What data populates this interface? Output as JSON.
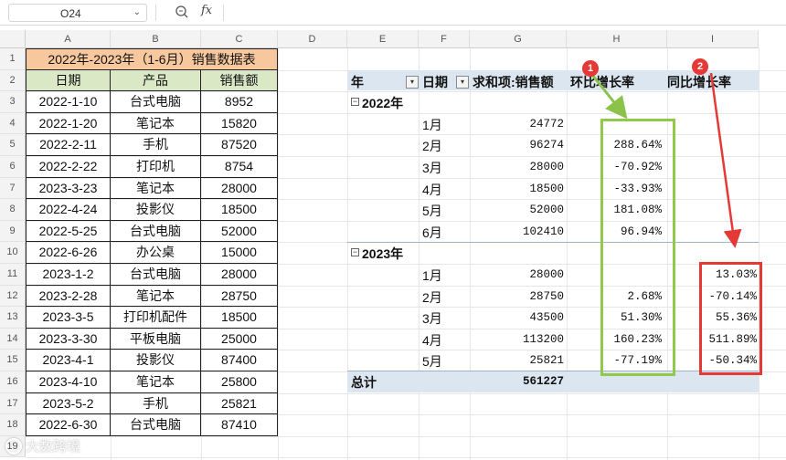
{
  "formula_bar": {
    "cell_ref": "O24",
    "fx_label": "fx",
    "formula": ""
  },
  "columns": [
    "A",
    "B",
    "C",
    "D",
    "E",
    "F",
    "G",
    "H",
    "I"
  ],
  "rows": [
    "1",
    "2",
    "3",
    "4",
    "5",
    "6",
    "7",
    "8",
    "9",
    "10",
    "11",
    "12",
    "13",
    "14",
    "15",
    "16",
    "17",
    "18",
    "19"
  ],
  "source_table": {
    "title": "2022年-2023年（1-6月）销售数据表",
    "headers": [
      "日期",
      "产品",
      "销售额"
    ],
    "rows": [
      [
        "2022-1-10",
        "台式电脑",
        "8952"
      ],
      [
        "2022-1-20",
        "笔记本",
        "15820"
      ],
      [
        "2022-2-11",
        "手机",
        "87520"
      ],
      [
        "2022-2-22",
        "打印机",
        "8754"
      ],
      [
        "2023-3-23",
        "笔记本",
        "28000"
      ],
      [
        "2022-4-24",
        "投影仪",
        "18500"
      ],
      [
        "2022-5-25",
        "台式电脑",
        "52000"
      ],
      [
        "2022-6-26",
        "办公桌",
        "15000"
      ],
      [
        "2023-1-2",
        "台式电脑",
        "28000"
      ],
      [
        "2023-2-28",
        "笔记本",
        "28750"
      ],
      [
        "2023-3-5",
        "打印机配件",
        "18500"
      ],
      [
        "2023-3-30",
        "平板电脑",
        "25000"
      ],
      [
        "2023-4-1",
        "投影仪",
        "87400"
      ],
      [
        "2023-4-10",
        "笔记本",
        "25800"
      ],
      [
        "2023-5-2",
        "手机",
        "25821"
      ],
      [
        "2022-6-30",
        "台式电脑",
        "87410"
      ]
    ]
  },
  "pivot": {
    "headers": {
      "year": "年",
      "date": "日期",
      "sum": "求和项:销售额",
      "mom": "环比增长率",
      "yoy": "同比增长率"
    },
    "groups": [
      {
        "year": "2022年",
        "rows": [
          {
            "month": "1月",
            "sales": "24772",
            "mom": "",
            "yoy": ""
          },
          {
            "month": "2月",
            "sales": "96274",
            "mom": "288.64%",
            "yoy": ""
          },
          {
            "month": "3月",
            "sales": "28000",
            "mom": "-70.92%",
            "yoy": ""
          },
          {
            "month": "4月",
            "sales": "18500",
            "mom": "-33.93%",
            "yoy": ""
          },
          {
            "month": "5月",
            "sales": "52000",
            "mom": "181.08%",
            "yoy": ""
          },
          {
            "month": "6月",
            "sales": "102410",
            "mom": "96.94%",
            "yoy": ""
          }
        ]
      },
      {
        "year": "2023年",
        "rows": [
          {
            "month": "1月",
            "sales": "28000",
            "mom": "",
            "yoy": "13.03%"
          },
          {
            "month": "2月",
            "sales": "28750",
            "mom": "2.68%",
            "yoy": "-70.14%"
          },
          {
            "month": "3月",
            "sales": "43500",
            "mom": "51.30%",
            "yoy": "55.36%"
          },
          {
            "month": "4月",
            "sales": "113200",
            "mom": "160.23%",
            "yoy": "511.89%"
          },
          {
            "month": "5月",
            "sales": "25821",
            "mom": "-77.19%",
            "yoy": "-50.34%"
          }
        ]
      }
    ],
    "total_label": "总计",
    "total_value": "561227"
  },
  "annotations": {
    "badge_1": "1",
    "badge_2": "2",
    "green": "#92c94a",
    "red": "#e53935"
  },
  "watermark": "大数跨境",
  "colors": {
    "title_bg": "#f7c89e",
    "header_bg": "#dbe8c6",
    "pivot_header_bg": "#dce6f0"
  }
}
